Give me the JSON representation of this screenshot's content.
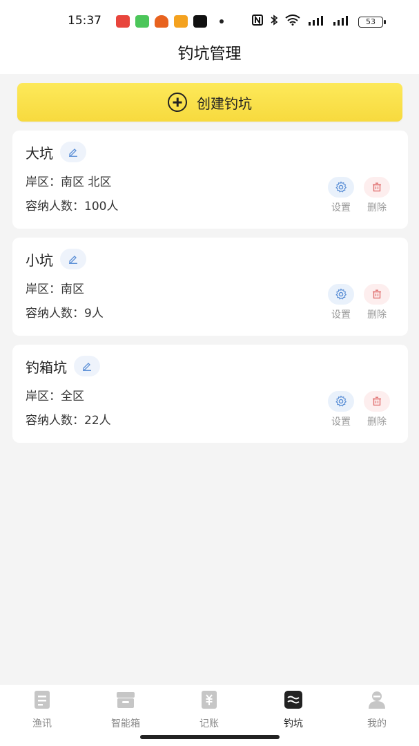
{
  "status_bar": {
    "time": "15:37",
    "battery": "53"
  },
  "header": {
    "title": "钓坑管理"
  },
  "create_button": {
    "label": "创建钓坑"
  },
  "ponds": [
    {
      "name": "大坑",
      "shore_label": "岸区：",
      "shore_value": "南区 北区",
      "capacity_label": "容纳人数：",
      "capacity_value": "100人"
    },
    {
      "name": "小坑",
      "shore_label": "岸区：",
      "shore_value": "南区",
      "capacity_label": "容纳人数：",
      "capacity_value": "9人"
    },
    {
      "name": "钓箱坑",
      "shore_label": "岸区：",
      "shore_value": "全区",
      "capacity_label": "容纳人数：",
      "capacity_value": "22人"
    }
  ],
  "actions": {
    "settings_label": "设置",
    "delete_label": "删除"
  },
  "tabs": [
    {
      "label": "渔讯",
      "icon": "news-icon"
    },
    {
      "label": "智能箱",
      "icon": "box-icon"
    },
    {
      "label": "记账",
      "icon": "ledger-icon"
    },
    {
      "label": "钓坑",
      "icon": "pond-icon",
      "active": true
    },
    {
      "label": "我的",
      "icon": "profile-icon"
    }
  ],
  "colors": {
    "accent_yellow": "#f9de47",
    "settings_blue": "#5b8fd6",
    "delete_red": "#e07070"
  }
}
